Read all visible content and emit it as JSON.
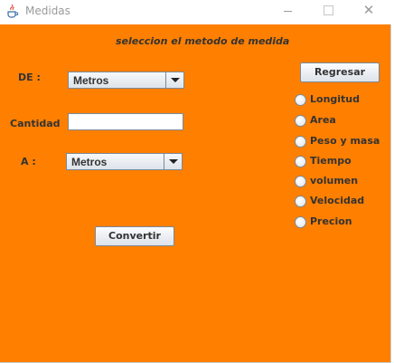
{
  "window": {
    "title": "Medidas",
    "controls": {
      "minimize": "—",
      "maximize": "☐",
      "close": "✕"
    }
  },
  "form": {
    "heading": "seleccion el metodo de medida",
    "de_label": "DE :",
    "de_value": "Metros",
    "cantidad_label": "Cantidad",
    "cantidad_value": "",
    "a_label": "A :",
    "a_value": "Metros",
    "convert_label": "Convertir"
  },
  "sidebar": {
    "back_label": "Regresar",
    "options": [
      "Longitud",
      "Area",
      "Peso y masa",
      "Tiempo",
      "volumen",
      "Velocidad",
      "Precion"
    ]
  },
  "colors": {
    "background": "#ff7f00"
  }
}
